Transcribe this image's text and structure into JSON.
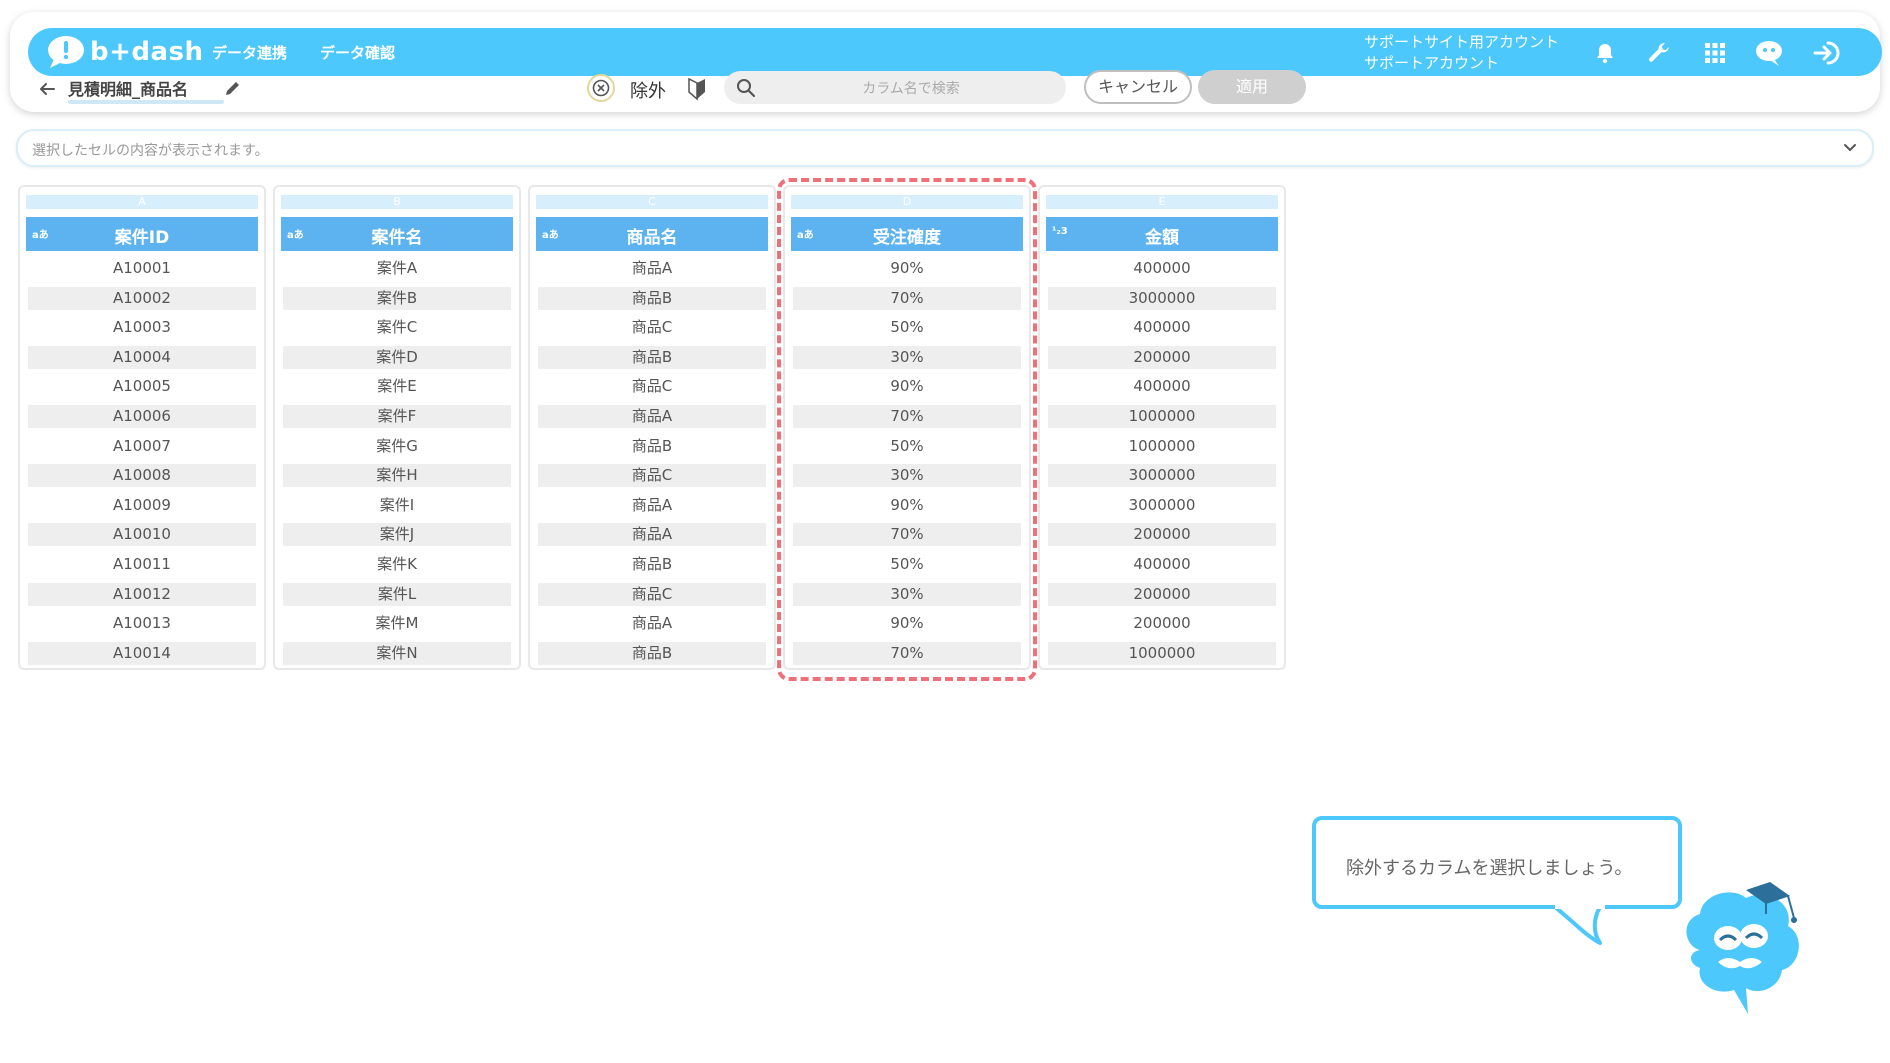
{
  "header": {
    "logo_text": "b+dash",
    "nav": [
      "データ連携",
      "データ確認"
    ],
    "account_line1": "サポートサイト用アカウント",
    "account_line2": "サポートアカウント",
    "icons": [
      "bell-icon",
      "wrench-icon",
      "apps-grid-icon",
      "chat-brain-icon",
      "logout-icon"
    ]
  },
  "toolbar": {
    "page_title": "見積明細_商品名",
    "exclude_label": "除外",
    "search_placeholder": "カラム名で検索",
    "cancel_label": "キャンセル",
    "apply_label": "適用"
  },
  "cell_bar": {
    "placeholder": "選択したセルの内容が表示されます。"
  },
  "columns": [
    {
      "letter": "A",
      "type": "aあ",
      "name": "案件ID",
      "cells": [
        "A10001",
        "A10002",
        "A10003",
        "A10004",
        "A10005",
        "A10006",
        "A10007",
        "A10008",
        "A10009",
        "A10010",
        "A10011",
        "A10012",
        "A10013",
        "A10014"
      ]
    },
    {
      "letter": "B",
      "type": "aあ",
      "name": "案件名",
      "cells": [
        "案件A",
        "案件B",
        "案件C",
        "案件D",
        "案件E",
        "案件F",
        "案件G",
        "案件H",
        "案件I",
        "案件J",
        "案件K",
        "案件L",
        "案件M",
        "案件N"
      ]
    },
    {
      "letter": "C",
      "type": "aあ",
      "name": "商品名",
      "cells": [
        "商品A",
        "商品B",
        "商品C",
        "商品B",
        "商品C",
        "商品A",
        "商品B",
        "商品C",
        "商品A",
        "商品A",
        "商品B",
        "商品C",
        "商品A",
        "商品B"
      ]
    },
    {
      "letter": "D",
      "type": "aあ",
      "name": "受注確度",
      "cells": [
        "90%",
        "70%",
        "50%",
        "30%",
        "90%",
        "70%",
        "50%",
        "30%",
        "90%",
        "70%",
        "50%",
        "30%",
        "90%",
        "70%"
      ]
    },
    {
      "letter": "E",
      "type": "¹₂3",
      "name": "金額",
      "cells": [
        "400000",
        "3000000",
        "400000",
        "200000",
        "400000",
        "1000000",
        "1000000",
        "3000000",
        "3000000",
        "200000",
        "400000",
        "200000",
        "200000",
        "1000000"
      ]
    }
  ],
  "tooltip": {
    "text": "除外するカラムを選択しましょう。"
  },
  "colors": {
    "accent": "#4cc8fd",
    "header_blue": "#5cb3f0",
    "highlight": "#f0707a"
  }
}
